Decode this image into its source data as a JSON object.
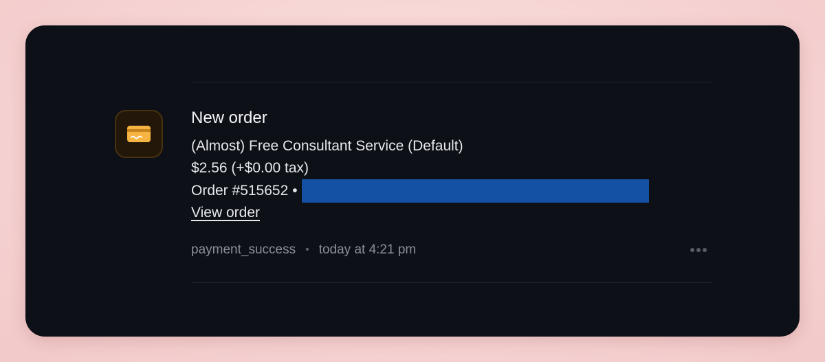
{
  "notification": {
    "icon": "credit-card-icon",
    "title": "New order",
    "product": "(Almost) Free Consultant Service (Default)",
    "price": "$2.56 (+$0.00 tax)",
    "order_number": "Order #515652",
    "separator": "•",
    "view_order_label": "View order",
    "event": "payment_success",
    "meta_separator": "•",
    "timestamp": "today at 4:21 pm"
  },
  "colors": {
    "card_background": "#0d1017",
    "icon_accent": "#f5a623",
    "redaction": "#1451a5",
    "page_background": "#f6d3d3"
  }
}
